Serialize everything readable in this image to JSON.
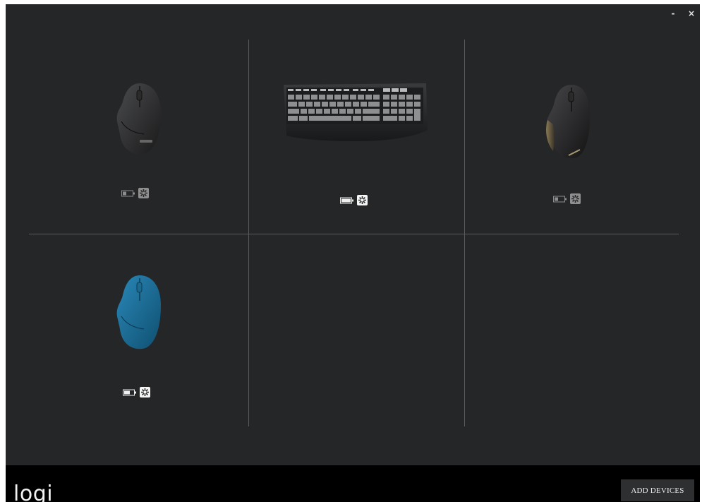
{
  "window": {
    "minimize_label": "-",
    "close_label": "×"
  },
  "devices": [
    {
      "id": "mouse-black",
      "battery": "medium",
      "connection": "unifying",
      "selected": false
    },
    {
      "id": "keyboard",
      "battery": "high",
      "connection": "unifying",
      "selected": true
    },
    {
      "id": "mouse-mx-gaming",
      "battery": "medium",
      "connection": "unifying",
      "selected": false
    },
    {
      "id": "mouse-blue",
      "battery": "medium",
      "connection": "unifying",
      "selected": true
    }
  ],
  "footer": {
    "logo": "logi",
    "add_devices_label": "ADD DEVICES"
  },
  "colors": {
    "background": "#252627",
    "divider": "#5a5b5c",
    "footer": "#000000",
    "accent_blue": "#1e6f9a"
  }
}
